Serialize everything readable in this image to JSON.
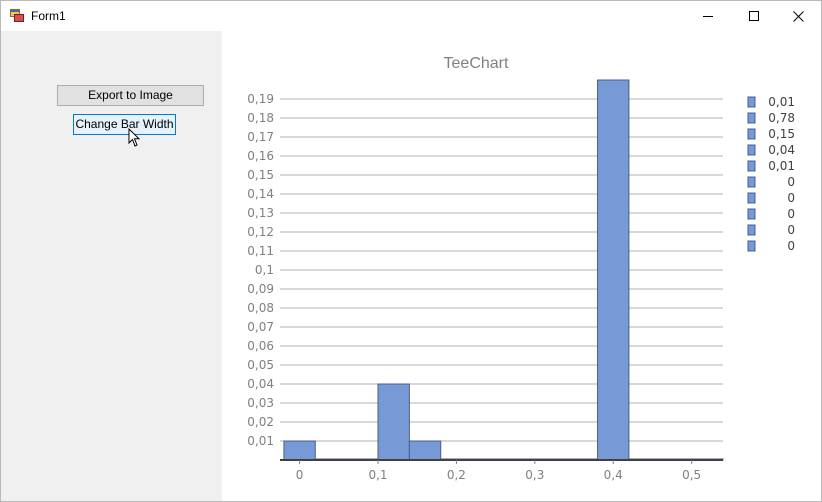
{
  "window": {
    "title": "Form1"
  },
  "buttons": {
    "export_label": "Export to Image",
    "width_label": "Change Bar Width"
  },
  "icons": {
    "app": "form-app-icon",
    "minimize": "minimize-icon",
    "maximize": "maximize-icon",
    "close": "close-icon",
    "cursor": "mouse-cursor-icon"
  },
  "colors": {
    "bar": "#7799d5",
    "bar_edge": "#4a5d8c",
    "grid": "#b0b0b0",
    "panel": "#f0f0f0"
  },
  "chart_data": {
    "type": "bar",
    "title": "TeeChart",
    "xlabel": "",
    "ylabel": "",
    "x": [
      0,
      0.04,
      0.08,
      0.12,
      0.16,
      0.2,
      0.24,
      0.28,
      0.32,
      0.36,
      0.4,
      0.44,
      0.48,
      0.52
    ],
    "values": [
      0.01,
      0,
      0,
      0.04,
      0.01,
      0.0004,
      0.0004,
      0.0004,
      0.0004,
      0.0004,
      0.2,
      0,
      0,
      0
    ],
    "bar_width": 0.04,
    "ylim": [
      0,
      0.2
    ],
    "xlim": [
      -0.025,
      0.54
    ],
    "y_ticks": [
      "0,01",
      "0,02",
      "0,03",
      "0,04",
      "0,05",
      "0,06",
      "0,07",
      "0,08",
      "0,09",
      "0,1",
      "0,11",
      "0,12",
      "0,13",
      "0,14",
      "0,15",
      "0,16",
      "0,17",
      "0,18",
      "0,19"
    ],
    "x_ticks": [
      "0",
      "0,1",
      "0,2",
      "0,3",
      "0,4",
      "0,5"
    ],
    "grid": true,
    "legend_position": "right",
    "legend": [
      "0,01",
      "0,78",
      "0,15",
      "0,04",
      "0,01",
      "0",
      "0",
      "0",
      "0",
      "0"
    ]
  }
}
